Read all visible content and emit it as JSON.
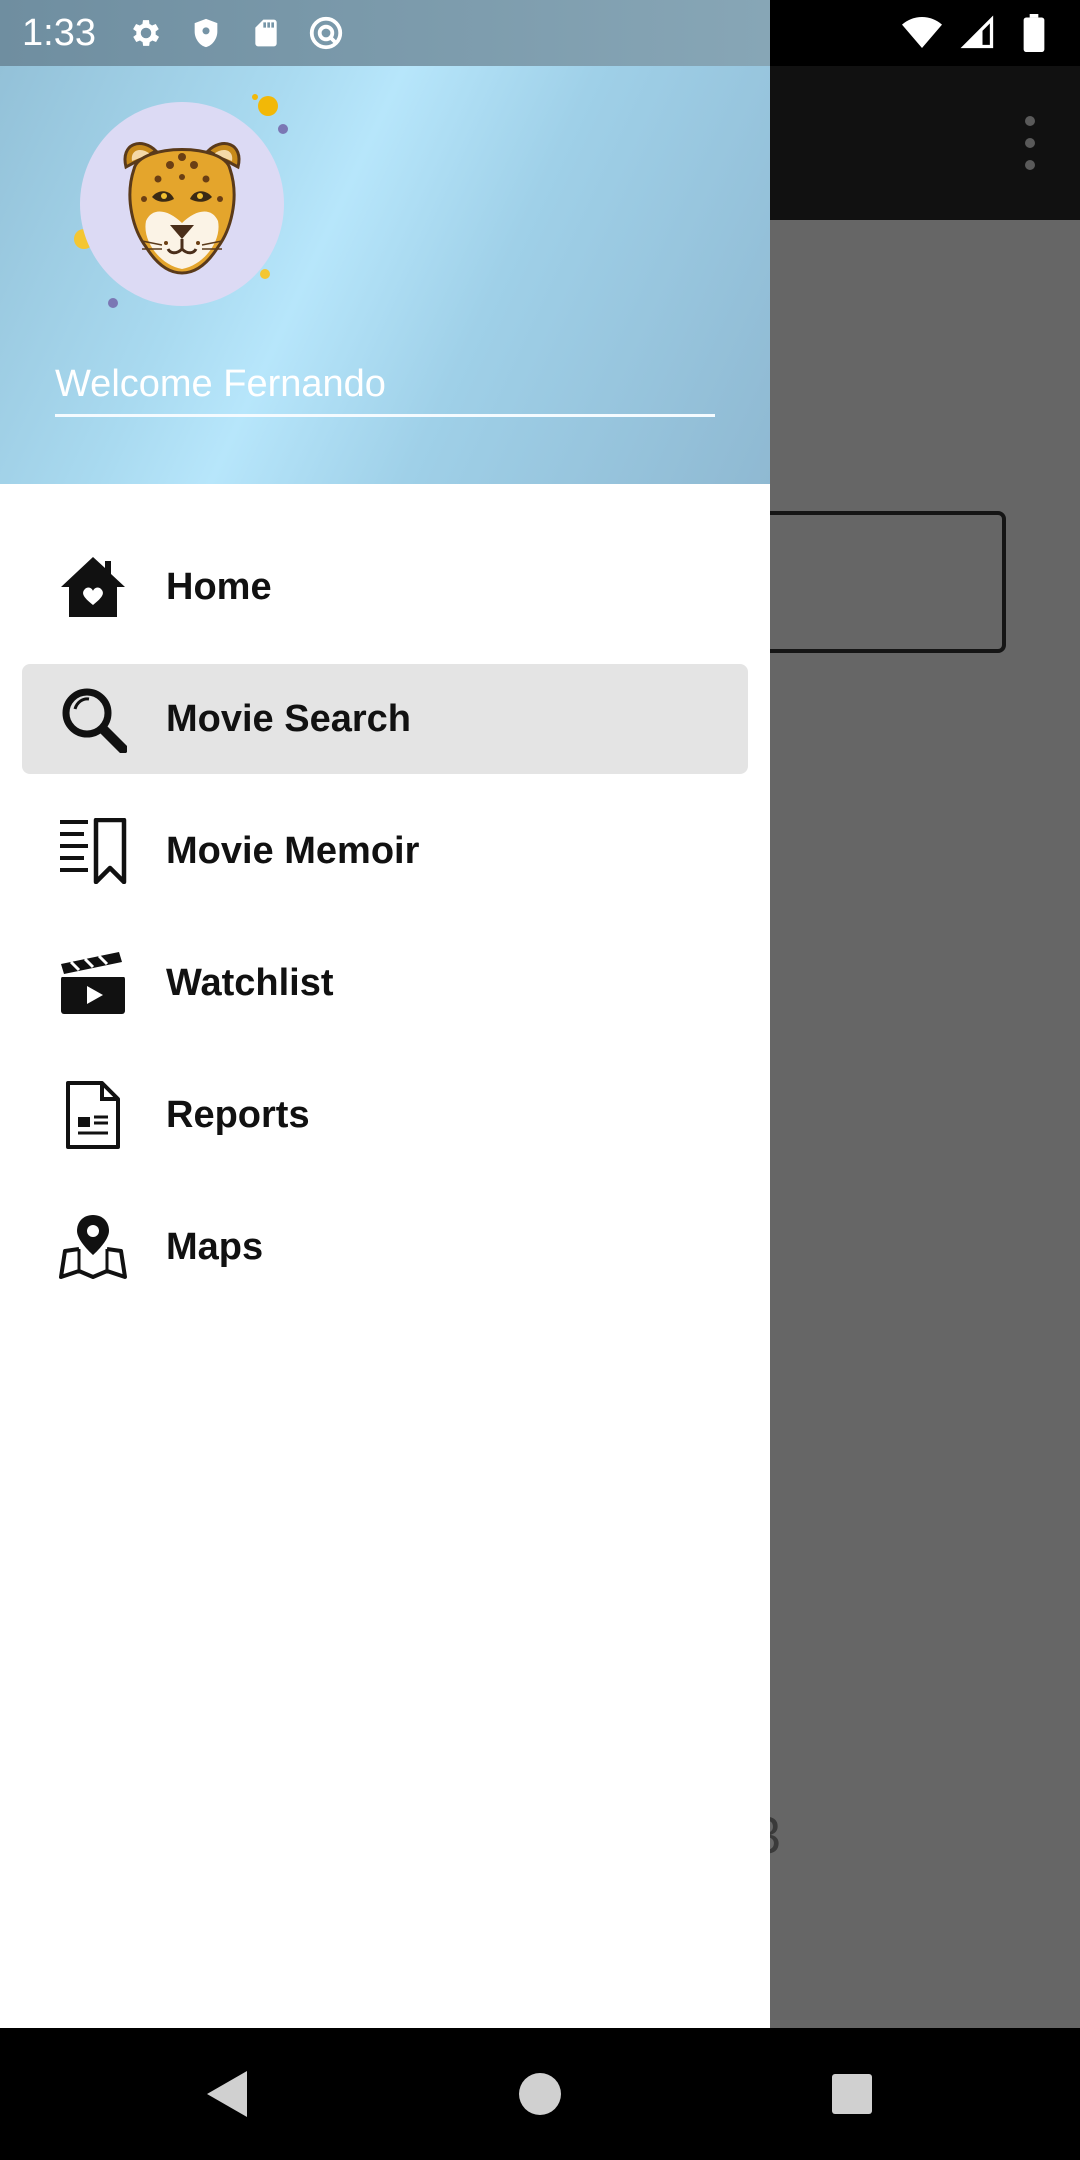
{
  "status_bar": {
    "time": "1:33",
    "left_icons": [
      "settings-icon",
      "shield-icon",
      "sd-card-icon",
      "sync-icon"
    ],
    "right_icons": [
      "wifi-icon",
      "cell-signal-icon",
      "battery-icon"
    ]
  },
  "background_app": {
    "menu_icon": "more-vert-icon",
    "partial_glyph": "3"
  },
  "drawer": {
    "header": {
      "avatar_icon": "jaguar-avatar-icon",
      "welcome_text": "Welcome Fernando"
    },
    "menu": [
      {
        "label": "Home",
        "icon": "home-icon",
        "selected": false
      },
      {
        "label": "Movie Search",
        "icon": "search-icon",
        "selected": true
      },
      {
        "label": "Movie Memoir",
        "icon": "memoir-bookmark-icon",
        "selected": false
      },
      {
        "label": "Watchlist",
        "icon": "clapperboard-icon",
        "selected": false
      },
      {
        "label": "Reports",
        "icon": "report-document-icon",
        "selected": false
      },
      {
        "label": "Maps",
        "icon": "map-pin-icon",
        "selected": false
      }
    ]
  },
  "nav_bar": {
    "buttons": [
      "back-icon",
      "home-circle-icon",
      "recents-icon"
    ]
  },
  "colors": {
    "header_gradient": [
      "#93c1d8",
      "#b7e6fb",
      "#8fb9d2"
    ],
    "selected_item_bg": "#e4e4e4",
    "scrim": "#666666"
  }
}
